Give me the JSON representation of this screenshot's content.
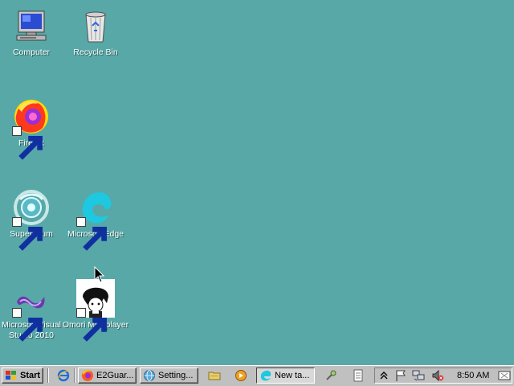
{
  "desktop": {
    "background_color": "#58a8a8",
    "icons": [
      {
        "label": "Computer",
        "icon": "computer-icon"
      },
      {
        "label": "Recycle Bin",
        "icon": "recycle-bin-icon"
      },
      {
        "label": "Firefox",
        "icon": "firefox-icon",
        "shortcut": true
      },
      {
        "label": "Supermium",
        "icon": "supermium-icon",
        "shortcut": true
      },
      {
        "label": "Microsoft Edge",
        "icon": "edge-icon",
        "shortcut": true
      },
      {
        "label": "Microsoft Visual Studio 2010",
        "icon": "visual-studio-icon",
        "shortcut": true
      },
      {
        "label": "Omori Multiplayer",
        "icon": "omori-icon",
        "shortcut": true
      }
    ]
  },
  "taskbar": {
    "start_label": "Start",
    "quick_launch": [
      "internet-explorer-icon"
    ],
    "tasks": [
      {
        "label": "E2Guar...",
        "icon": "firefox-icon",
        "active": false
      },
      {
        "label": "Setting...",
        "icon": "settings-globe-icon",
        "active": false
      },
      {
        "label": "New ta...",
        "icon": "edge-icon",
        "active": true
      }
    ],
    "tray": {
      "icons": [
        "chevron-up-icon",
        "flag-icon",
        "network-icon",
        "volume-muted-icon"
      ],
      "clock": "8:50 AM"
    }
  }
}
